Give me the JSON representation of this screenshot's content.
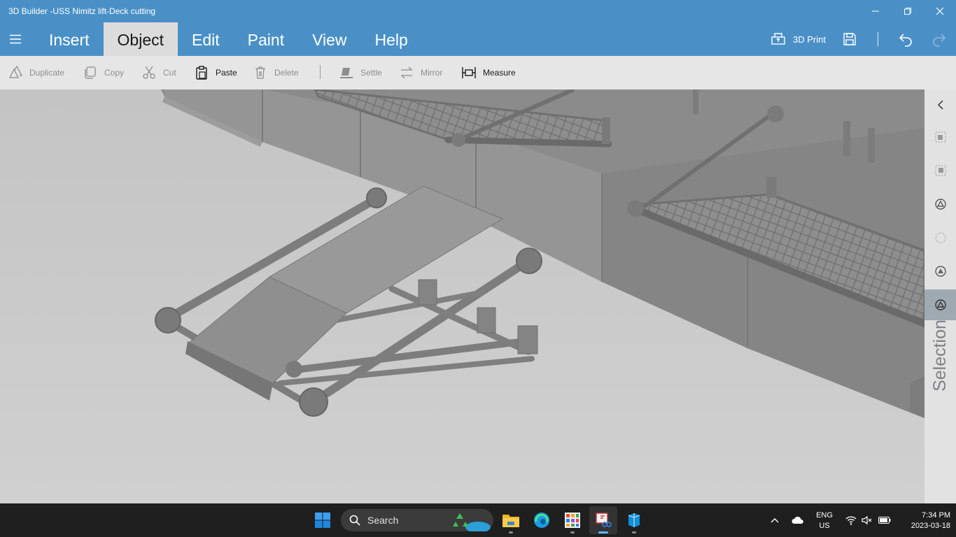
{
  "window": {
    "title": "3D Builder -USS Nimitz lift-Deck cutting"
  },
  "menu": {
    "tabs": [
      {
        "label": "Insert"
      },
      {
        "label": "Object"
      },
      {
        "label": "Edit"
      },
      {
        "label": "Paint"
      },
      {
        "label": "View"
      },
      {
        "label": "Help"
      }
    ],
    "active_tab": "Object",
    "print_label": "3D Print"
  },
  "toolbar": {
    "duplicate": "Duplicate",
    "copy": "Copy",
    "cut": "Cut",
    "paste": "Paste",
    "delete": "Delete",
    "settle": "Settle",
    "mirror": "Mirror",
    "measure": "Measure"
  },
  "panel": {
    "selection_label": "Selection"
  },
  "taskbar": {
    "search_label": "Search",
    "lang_line1": "ENG",
    "lang_line2": "US",
    "time": "7:34 PM",
    "date": "2023-03-18"
  },
  "colors": {
    "accent": "#4a90c6",
    "toolbar_bg": "#e6e6e6",
    "taskbar_bg": "#1f1f1f",
    "viewport_floor": "#cdcdcd",
    "model_gray": "#8a8a8a"
  }
}
